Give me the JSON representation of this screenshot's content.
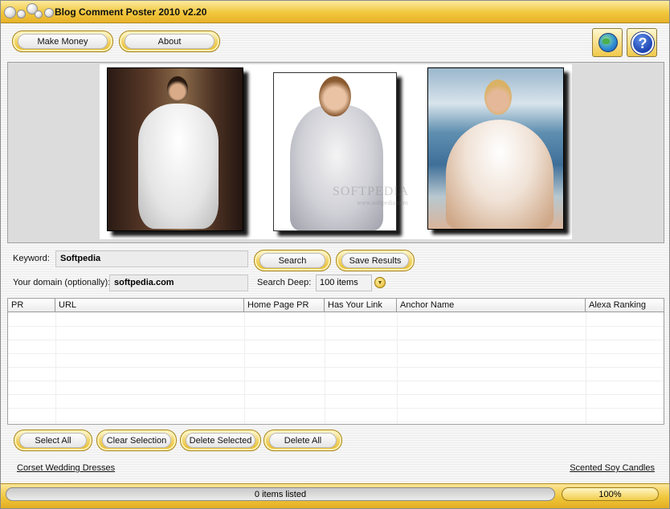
{
  "window": {
    "title": "Blog Comment Poster 2010 v2.20"
  },
  "toolbar": {
    "make_money_label": "Make Money",
    "about_label": "About",
    "web_icon": "globe-icon",
    "help_icon": "help-icon",
    "help_glyph": "?"
  },
  "banner": {
    "watermark": "SOFTPEDIA",
    "watermark_sub": "www.softpedia.com"
  },
  "search": {
    "keyword_label": "Keyword:",
    "keyword_value": "Softpedia",
    "search_button": "Search",
    "save_button": "Save Results",
    "domain_label": "Your domain (optionally):",
    "domain_value": "softpedia.com",
    "deep_label": "Search Deep:",
    "deep_value": "100 items"
  },
  "grid": {
    "columns": [
      "PR",
      "URL",
      "Home Page PR",
      "Has Your Link",
      "Anchor Name",
      "Alexa Ranking"
    ],
    "rows": []
  },
  "actions": {
    "select_all": "Select All",
    "clear_selection": "Clear Selection",
    "delete_selected": "Delete Selected",
    "delete_all": "Delete All"
  },
  "links": {
    "left": "Corset Wedding Dresses",
    "right": "Scented Soy Candles"
  },
  "status": {
    "items_text": "0 items listed",
    "percent_text": "100%"
  },
  "colors": {
    "accent_gold": "#f0c63a",
    "help_blue": "#1d44b2"
  }
}
